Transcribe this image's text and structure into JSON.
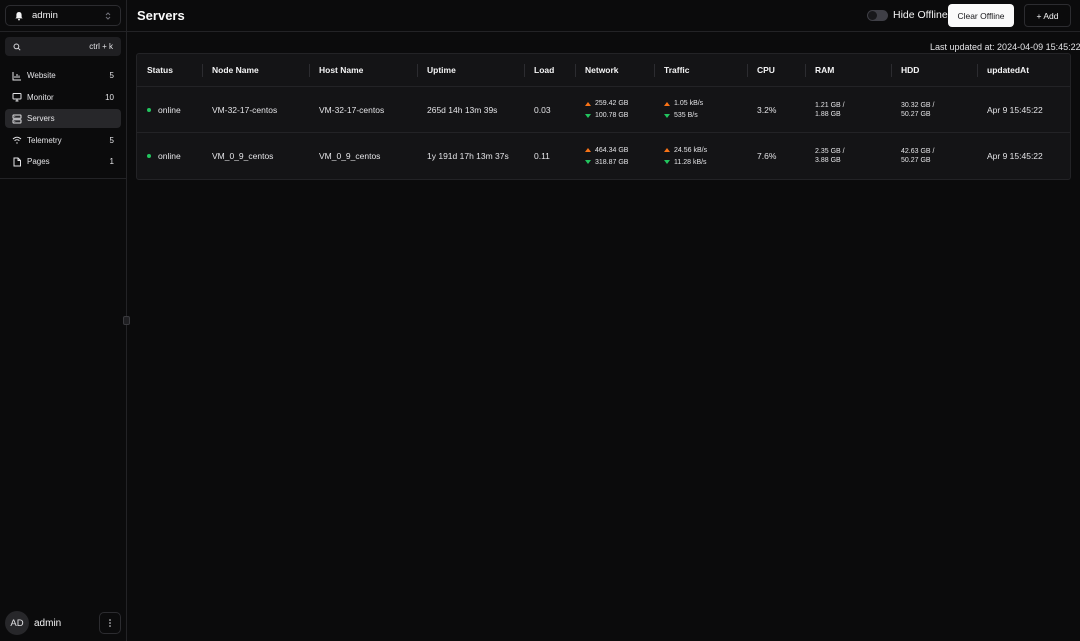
{
  "workspace": {
    "name": "admin"
  },
  "search": {
    "placeholder": "",
    "shortcut": "ctrl + k"
  },
  "nav": [
    {
      "label": "Website",
      "count": "5",
      "icon": "chart-icon"
    },
    {
      "label": "Monitor",
      "count": "10",
      "icon": "monitor-icon"
    },
    {
      "label": "Servers",
      "count": "",
      "icon": "server-icon",
      "active": true
    },
    {
      "label": "Telemetry",
      "count": "5",
      "icon": "wifi-icon"
    },
    {
      "label": "Pages",
      "count": "1",
      "icon": "file-icon"
    }
  ],
  "user": {
    "initials": "AD",
    "name": "admin"
  },
  "header": {
    "title": "Servers",
    "hide_offline_label": "Hide Offline",
    "clear_offline_label": "Clear Offline",
    "add_label": "+ Add"
  },
  "last_updated": "Last updated at: 2024-04-09 15:45:22",
  "table": {
    "columns": [
      "Status",
      "Node Name",
      "Host Name",
      "Uptime",
      "Load",
      "Network",
      "Traffic",
      "CPU",
      "RAM",
      "HDD",
      "updatedAt"
    ],
    "rows": [
      {
        "status": "online",
        "node": "VM-32-17-centos",
        "host": "VM-32-17-centos",
        "uptime": "265d 14h 13m 39s",
        "load": "0.03",
        "net_up": "259.42 GB",
        "net_down": "100.78 GB",
        "traffic_up": "1.05 kB/s",
        "traffic_down": "535 B/s",
        "cpu": "3.2%",
        "ram_used": "1.21 GB /",
        "ram_total": "1.88 GB",
        "hdd_used": "30.32 GB /",
        "hdd_total": "50.27 GB",
        "updated": "Apr 9 15:45:22"
      },
      {
        "status": "online",
        "node": "VM_0_9_centos",
        "host": "VM_0_9_centos",
        "uptime": "1y 191d 17h 13m 37s",
        "load": "0.11",
        "net_up": "464.34 GB",
        "net_down": "318.87 GB",
        "traffic_up": "24.56 kB/s",
        "traffic_down": "11.28 kB/s",
        "cpu": "7.6%",
        "ram_used": "2.35 GB /",
        "ram_total": "3.88 GB",
        "hdd_used": "42.63 GB /",
        "hdd_total": "50.27 GB",
        "updated": "Apr 9 15:45:22"
      }
    ]
  },
  "colors": {
    "online": "#22c55e",
    "upload": "#f97316",
    "download": "#22c55e"
  }
}
